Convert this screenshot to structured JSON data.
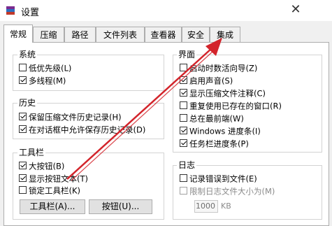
{
  "window": {
    "title": "设置"
  },
  "tabs": [
    {
      "label": "常规",
      "active": true
    },
    {
      "label": "压缩",
      "active": false
    },
    {
      "label": "路径",
      "active": false
    },
    {
      "label": "文件列表",
      "active": false
    },
    {
      "label": "查看器",
      "active": false
    },
    {
      "label": "安全",
      "active": false
    },
    {
      "label": "集成",
      "active": false
    }
  ],
  "system": {
    "title": "系统",
    "items": [
      {
        "label": "低优先级(L)",
        "checked": false
      },
      {
        "label": "多线程(M)",
        "checked": true
      }
    ]
  },
  "history": {
    "title": "历史",
    "items": [
      {
        "label": "保留压缩文件历史记录(H)",
        "checked": true
      },
      {
        "label": "在对话框中允许保存历史记录(D)",
        "checked": true
      }
    ]
  },
  "toolbar": {
    "title": "工具栏",
    "items": [
      {
        "label": "大按钮(B)",
        "checked": true
      },
      {
        "label": "显示按钮文本(T)",
        "checked": true
      },
      {
        "label": "锁定工具栏(K)",
        "checked": false
      }
    ],
    "toolbar_button": "工具栏(A)...",
    "buttons_button": "按钮(U)..."
  },
  "interface": {
    "title": "界面",
    "items": [
      {
        "label": "启动时数活向导(Z)",
        "checked": false
      },
      {
        "label": "启用声音(S)",
        "checked": true
      },
      {
        "label": "显示压缩文件注释(C)",
        "checked": true
      },
      {
        "label": "重复使用已存在的窗口(R)",
        "checked": false
      },
      {
        "label": "总在最前端(W)",
        "checked": false
      },
      {
        "label": "Windows 进度条(I)",
        "checked": true
      },
      {
        "label": "任务栏进度条(P)",
        "checked": true
      }
    ]
  },
  "log": {
    "title": "日志",
    "items": [
      {
        "label": "记录错误到文件(E)",
        "checked": false
      },
      {
        "label": "限制日志文件大小为(M)",
        "checked": false,
        "disabled": true
      }
    ],
    "size_value": "1000",
    "size_unit": "KB"
  },
  "colors": {
    "arrow": "#d3242b",
    "accent": "#0078d7"
  }
}
